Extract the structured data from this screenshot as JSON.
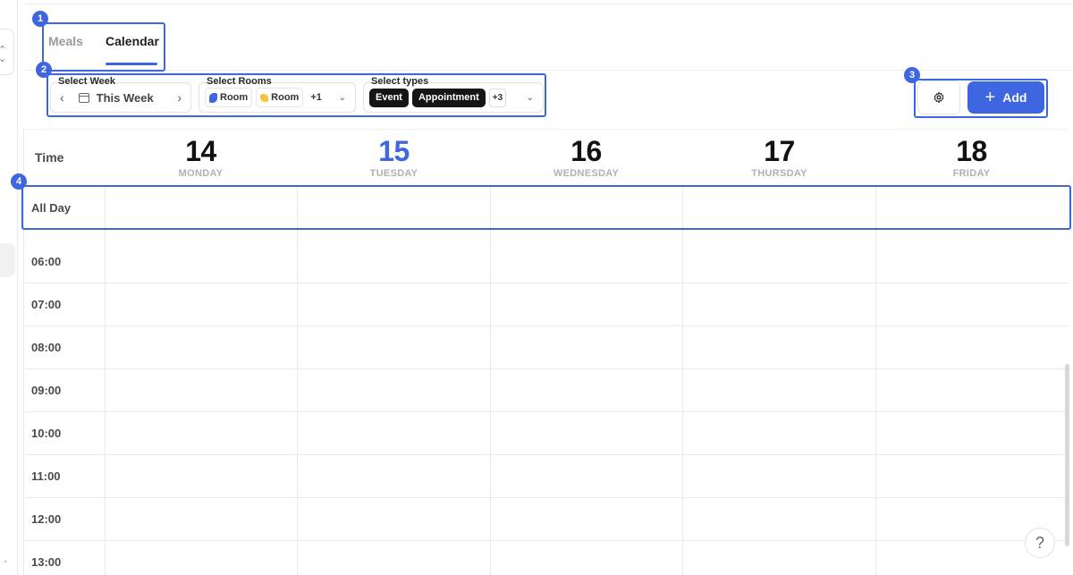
{
  "tabs": [
    {
      "label": "Meals",
      "active": false
    },
    {
      "label": "Calendar",
      "active": true
    }
  ],
  "filters": {
    "week": {
      "label": "Select Week",
      "value": "This Week",
      "prev_icon": "chevron-left-icon",
      "next_icon": "chevron-right-icon",
      "calendar_icon": "calendar-icon"
    },
    "rooms": {
      "label": "Select Rooms",
      "chips": [
        "Room",
        "Room"
      ],
      "more": "+1"
    },
    "types": {
      "label": "Select types",
      "chips": [
        "Event",
        "Appointment"
      ],
      "more": "+3"
    }
  },
  "actions": {
    "settings_icon": "gear-icon",
    "add_label": "Add"
  },
  "calendar": {
    "time_header": "Time",
    "days": [
      {
        "num": "14",
        "name": "MONDAY",
        "today": false
      },
      {
        "num": "15",
        "name": "TUESDAY",
        "today": true
      },
      {
        "num": "16",
        "name": "WEDNESDAY",
        "today": false
      },
      {
        "num": "17",
        "name": "THURSDAY",
        "today": false
      },
      {
        "num": "18",
        "name": "FRIDAY",
        "today": false
      }
    ],
    "all_day_label": "All Day",
    "hours": [
      "06:00",
      "07:00",
      "08:00",
      "09:00",
      "10:00",
      "11:00",
      "12:00",
      "13:00"
    ]
  },
  "annotations": [
    "1",
    "2",
    "3",
    "4"
  ],
  "help_label": "?",
  "colors": {
    "accent": "#3d66e0",
    "chip_dark": "#151515"
  }
}
